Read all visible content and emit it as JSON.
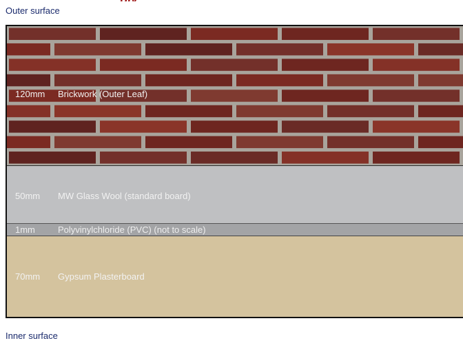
{
  "labels": {
    "outer_surface": "Outer surface",
    "inner_surface": "Inner surface"
  },
  "layers": [
    {
      "thickness": "120mm",
      "material": "Brickwork (Outer Leaf)",
      "color": "#7a2e26"
    },
    {
      "thickness": "50mm",
      "material": "MW Glass Wool (standard board)",
      "color": "#bfc0c2"
    },
    {
      "thickness": "1mm",
      "material": "Polyvinylchloride (PVC) (not to scale)",
      "color": "#a3a4a6"
    },
    {
      "thickness": "70mm",
      "material": "Gypsum Plasterboard",
      "color": "#d4c39e"
    }
  ]
}
